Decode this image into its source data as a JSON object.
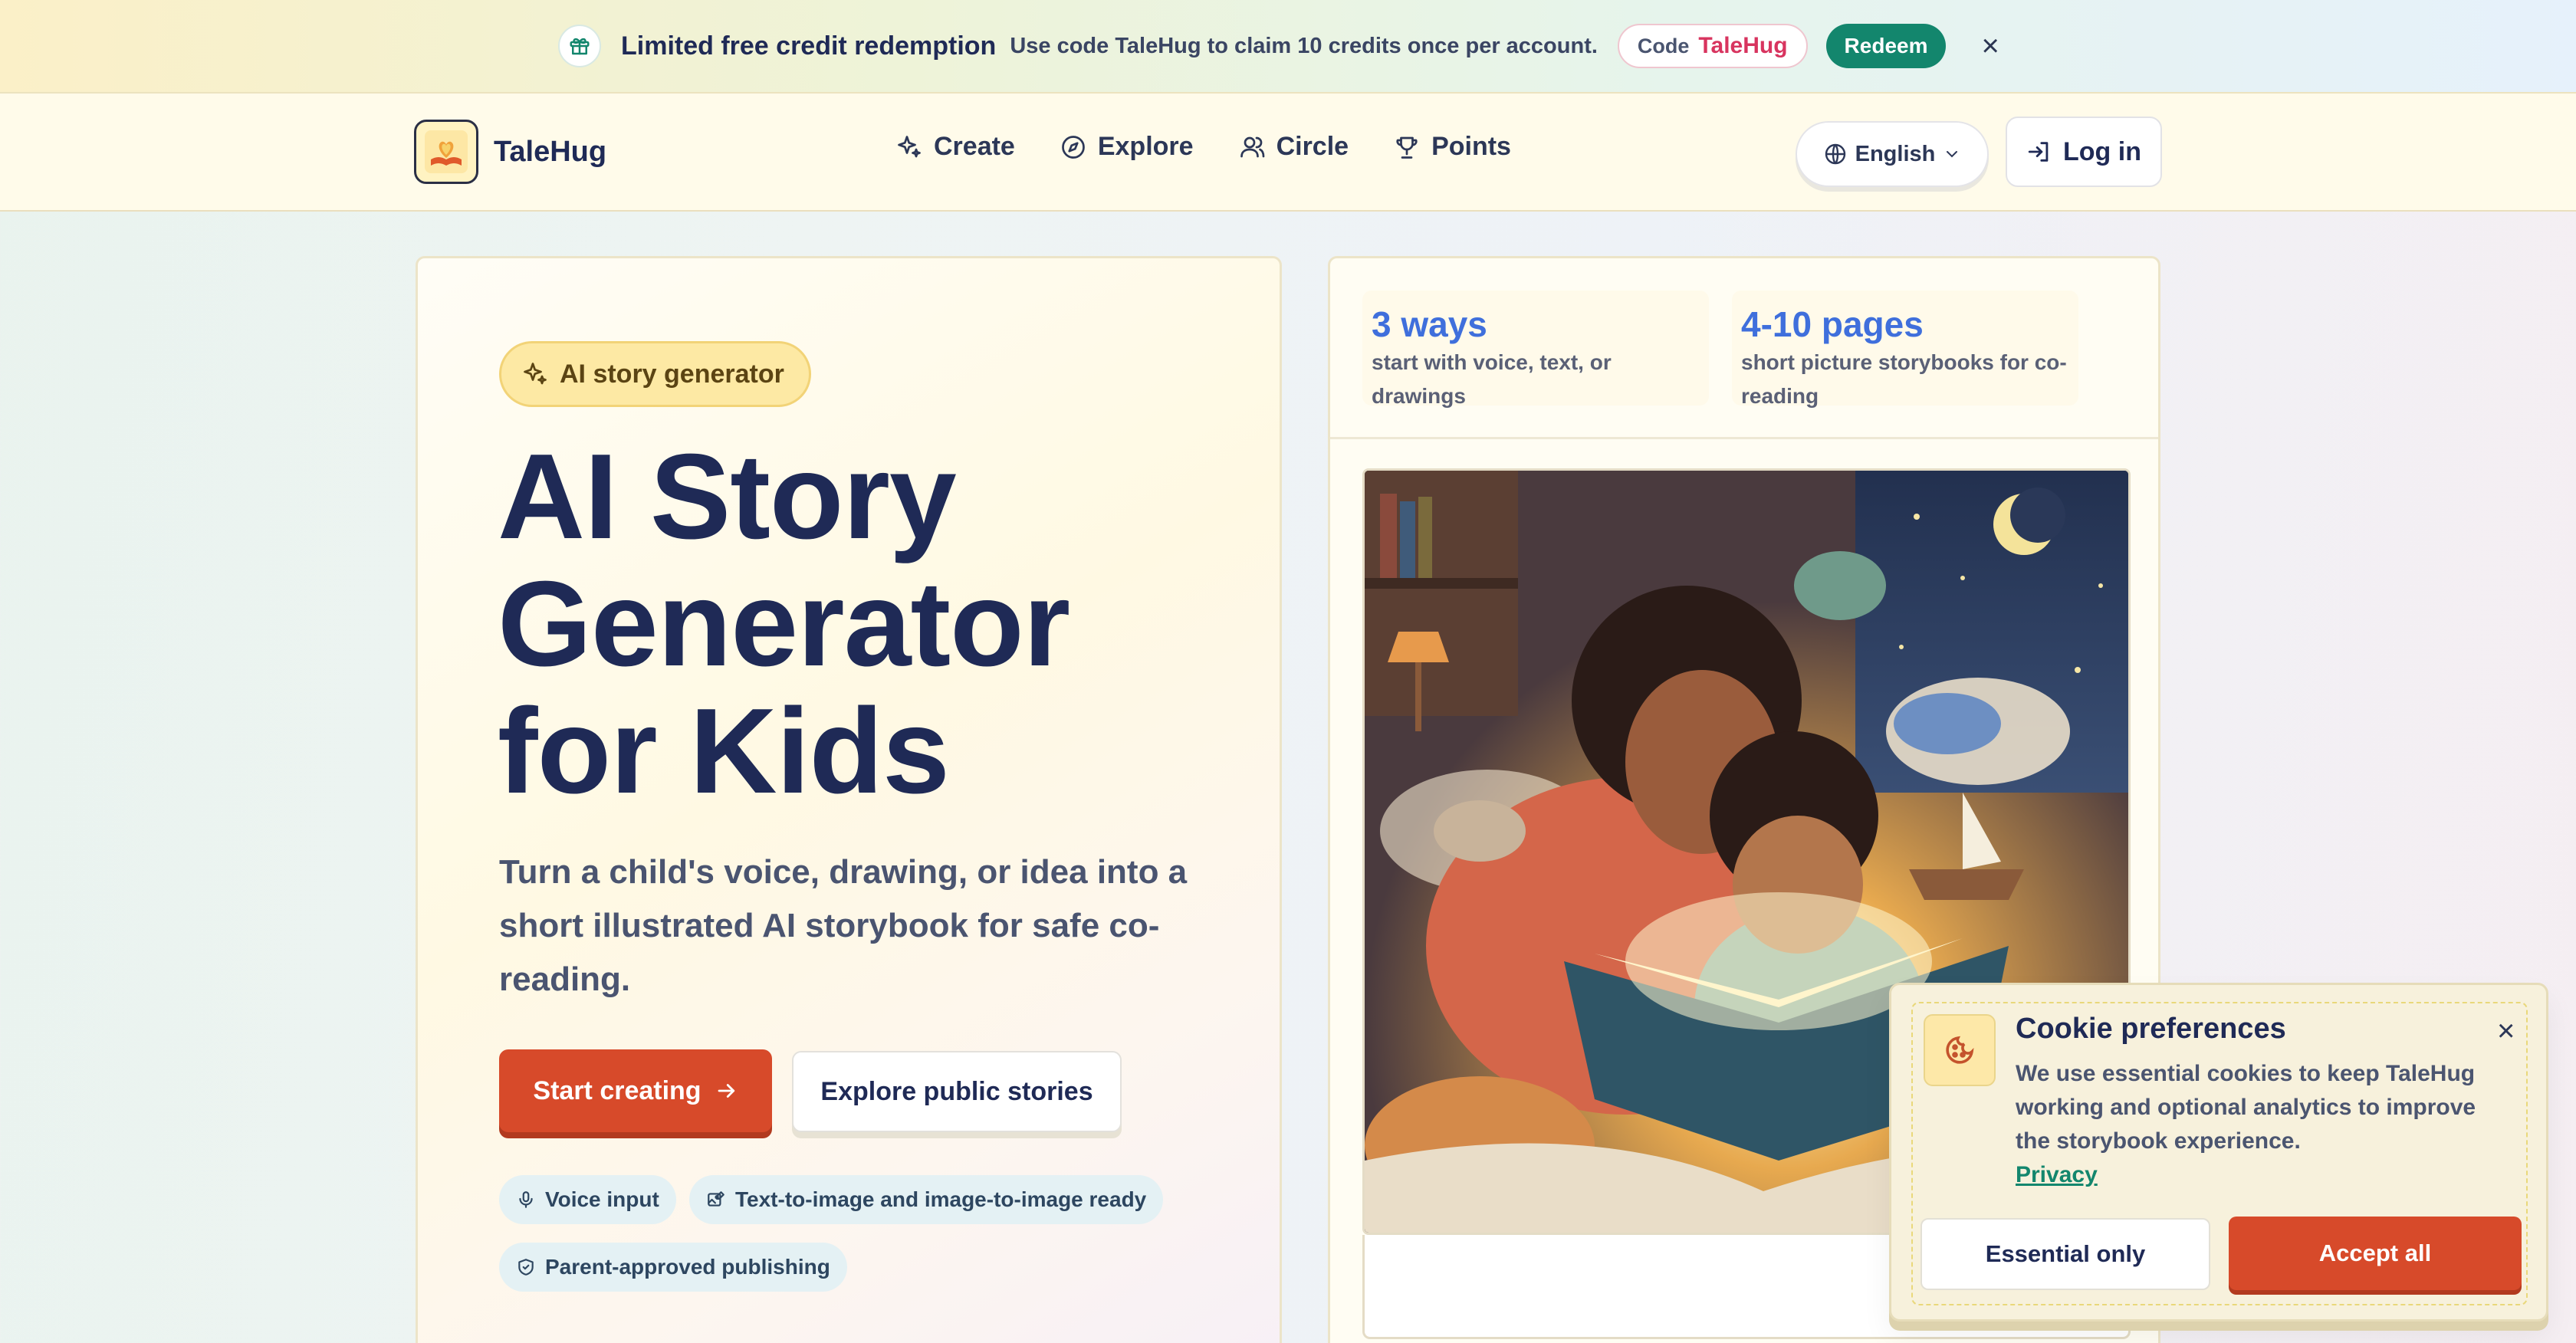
{
  "promo": {
    "title": "Limited free credit redemption",
    "description": "Use code TaleHug to claim 10 credits once per account.",
    "code_label": "Code",
    "code_value": "TaleHug",
    "redeem_label": "Redeem",
    "close_icon": "close-icon",
    "gift_icon": "gift-icon"
  },
  "header": {
    "brand": "TaleHug",
    "nav": [
      {
        "label": "Create",
        "icon": "sparkle-icon"
      },
      {
        "label": "Explore",
        "icon": "compass-icon"
      },
      {
        "label": "Circle",
        "icon": "people-icon"
      },
      {
        "label": "Points",
        "icon": "trophy-icon"
      }
    ],
    "language": "English",
    "login": "Log in"
  },
  "hero": {
    "badge": "AI story generator",
    "title": "AI Story Generator for Kids",
    "subtitle": "Turn a child's voice, drawing, or idea into a short illustrated AI storybook for safe co-reading.",
    "primary_cta": "Start creating",
    "secondary_cta": "Explore public stories",
    "chips": [
      {
        "label": "Voice input",
        "icon": "microphone-icon"
      },
      {
        "label": "Text-to-image and image-to-image ready",
        "icon": "image-edit-icon"
      },
      {
        "label": "Parent-approved publishing",
        "icon": "shield-icon"
      }
    ]
  },
  "stats": [
    {
      "big": "3 ways",
      "small": "start with voice, text, or drawings"
    },
    {
      "big": "4-10 pages",
      "small": "short picture storybooks for co-reading"
    }
  ],
  "cookie": {
    "title": "Cookie preferences",
    "text": "We use essential cookies to keep TaleHug working and optional analytics to improve the storybook experience.",
    "link": "Privacy",
    "essential": "Essential only",
    "accept": "Accept all"
  },
  "colors": {
    "accent": "#d74a2a",
    "teal": "#13866d",
    "navy": "#1f2a56",
    "stat_blue": "#3f6fdc"
  }
}
